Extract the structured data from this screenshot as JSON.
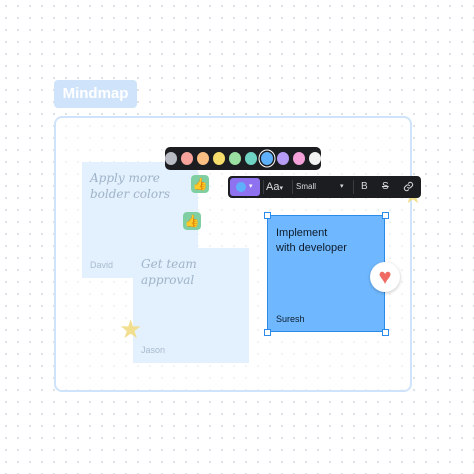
{
  "frame": {
    "label": "Mindmap"
  },
  "stickies": [
    {
      "text_line1": "Apply more",
      "text_line2": "bolder colors",
      "author": "David"
    },
    {
      "text_line1": "Get team",
      "text_line2": "approval",
      "author": "Jason"
    }
  ],
  "selected_sticky": {
    "text_line1": "Implement",
    "text_line2": "with developer",
    "author": "Suresh",
    "color": "#6fb8ff"
  },
  "palette": {
    "colors": [
      "#b9bcc4",
      "#f7a39b",
      "#fbbf83",
      "#f7dd6c",
      "#9ae0a1",
      "#6ed3c2",
      "#5fb0fb",
      "#b79cf6",
      "#f3a1d8",
      "#f2f2f2"
    ],
    "selected_index": 6
  },
  "toolbar": {
    "font_label": "Aa",
    "size_label": "Small",
    "bold_label": "B",
    "strike_label": "S",
    "chevron": "⌄"
  },
  "icons": {
    "thumbs_up": "thumbs-up-icon",
    "star": "star-icon",
    "heart": "heart-icon",
    "link": "link-icon"
  }
}
